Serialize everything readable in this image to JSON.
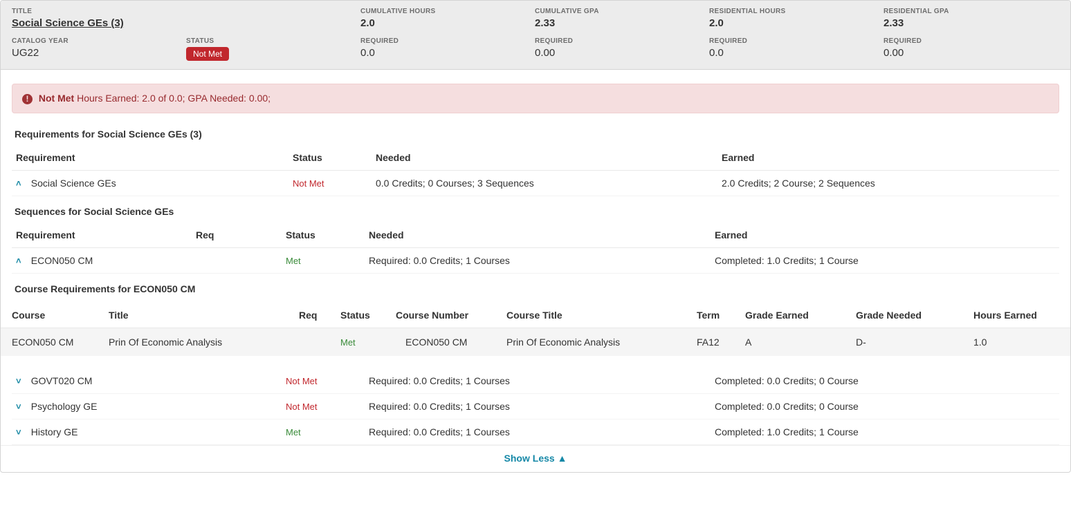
{
  "header": {
    "row1": {
      "title_label": "TITLE",
      "title_value": "Social Science GEs (3)",
      "cum_hours_label": "CUMULATIVE HOURS",
      "cum_hours_value": "2.0",
      "cum_gpa_label": "CUMULATIVE GPA",
      "cum_gpa_value": "2.33",
      "res_hours_label": "RESIDENTIAL HOURS",
      "res_hours_value": "2.0",
      "res_gpa_label": "RESIDENTIAL GPA",
      "res_gpa_value": "2.33"
    },
    "row2": {
      "catalog_label": "CATALOG YEAR",
      "catalog_value": "UG22",
      "status_label": "STATUS",
      "status_value": "Not Met",
      "req1_label": "REQUIRED",
      "req1_value": "0.0",
      "req2_label": "REQUIRED",
      "req2_value": "0.00",
      "req3_label": "REQUIRED",
      "req3_value": "0.0",
      "req4_label": "REQUIRED",
      "req4_value": "0.00"
    }
  },
  "alert": {
    "bold": "Not Met",
    "text": "Hours Earned: 2.0 of 0.0; GPA Needed: 0.00;"
  },
  "reqs_section_title": "Requirements for Social Science GEs (3)",
  "reqs_headers": {
    "requirement": "Requirement",
    "status": "Status",
    "needed": "Needed",
    "earned": "Earned"
  },
  "reqs_row": {
    "name": "Social Science GEs",
    "status": "Not Met",
    "needed": "0.0 Credits; 0 Courses; 3 Sequences",
    "earned": "2.0 Credits; 2 Course; 2 Sequences"
  },
  "seq_section_title": "Sequences for Social Science GEs",
  "seq_headers": {
    "requirement": "Requirement",
    "req": "Req",
    "status": "Status",
    "needed": "Needed",
    "earned": "Earned"
  },
  "seq_row_econ": {
    "name": "ECON050 CM",
    "status": "Met",
    "needed": "Required: 0.0 Credits; 1 Courses",
    "earned": "Completed: 1.0 Credits; 1 Course"
  },
  "coursereq_section_title": "Course Requirements for ECON050 CM",
  "course_headers": {
    "course": "Course",
    "title": "Title",
    "req": "Req",
    "status": "Status",
    "course_number": "Course Number",
    "course_title": "Course Title",
    "term": "Term",
    "grade_earned": "Grade Earned",
    "grade_needed": "Grade Needed",
    "hours_earned": "Hours Earned"
  },
  "course_row": {
    "course": "ECON050 CM",
    "title": "Prin Of Economic Analysis",
    "req": "",
    "status": "Met",
    "course_number": "ECON050 CM",
    "course_title": "Prin Of Economic Analysis",
    "term": "FA12",
    "grade_earned": "A",
    "grade_needed": "D-",
    "hours_earned": "1.0"
  },
  "seq_rows_more": [
    {
      "name": "GOVT020 CM",
      "status": "Not Met",
      "needed": "Required: 0.0 Credits; 1 Courses",
      "earned": "Completed: 0.0 Credits; 0 Course"
    },
    {
      "name": "Psychology GE",
      "status": "Not Met",
      "needed": "Required: 0.0 Credits; 1 Courses",
      "earned": "Completed: 0.0 Credits; 0 Course"
    },
    {
      "name": "History GE",
      "status": "Met",
      "needed": "Required: 0.0 Credits; 1 Courses",
      "earned": "Completed: 1.0 Credits; 1 Course"
    }
  ],
  "footer": {
    "show_less": "Show Less ▲"
  }
}
